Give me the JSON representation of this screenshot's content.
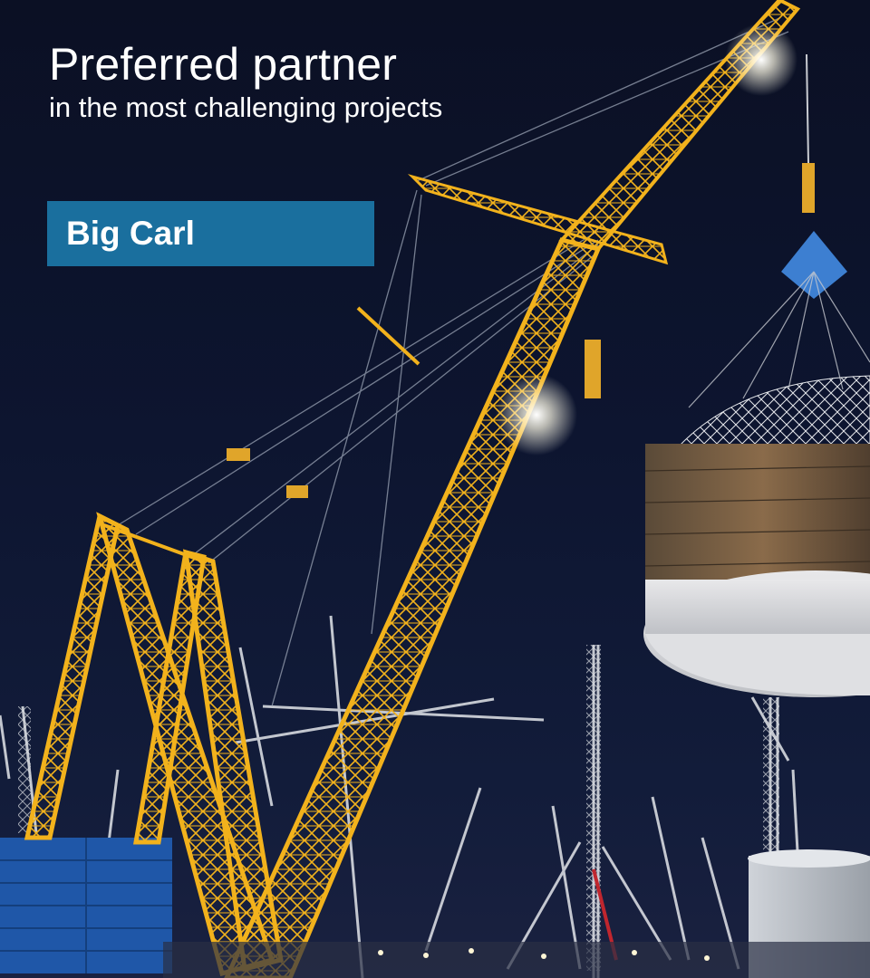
{
  "headline": {
    "title": "Preferred partner",
    "subtitle": "in the most challenging projects"
  },
  "label": "Big Carl",
  "colors": {
    "sky": "#0b1126",
    "label_background": "#1a6f9e",
    "crane": "#f2b21c",
    "dome": "#c9c9c9"
  }
}
